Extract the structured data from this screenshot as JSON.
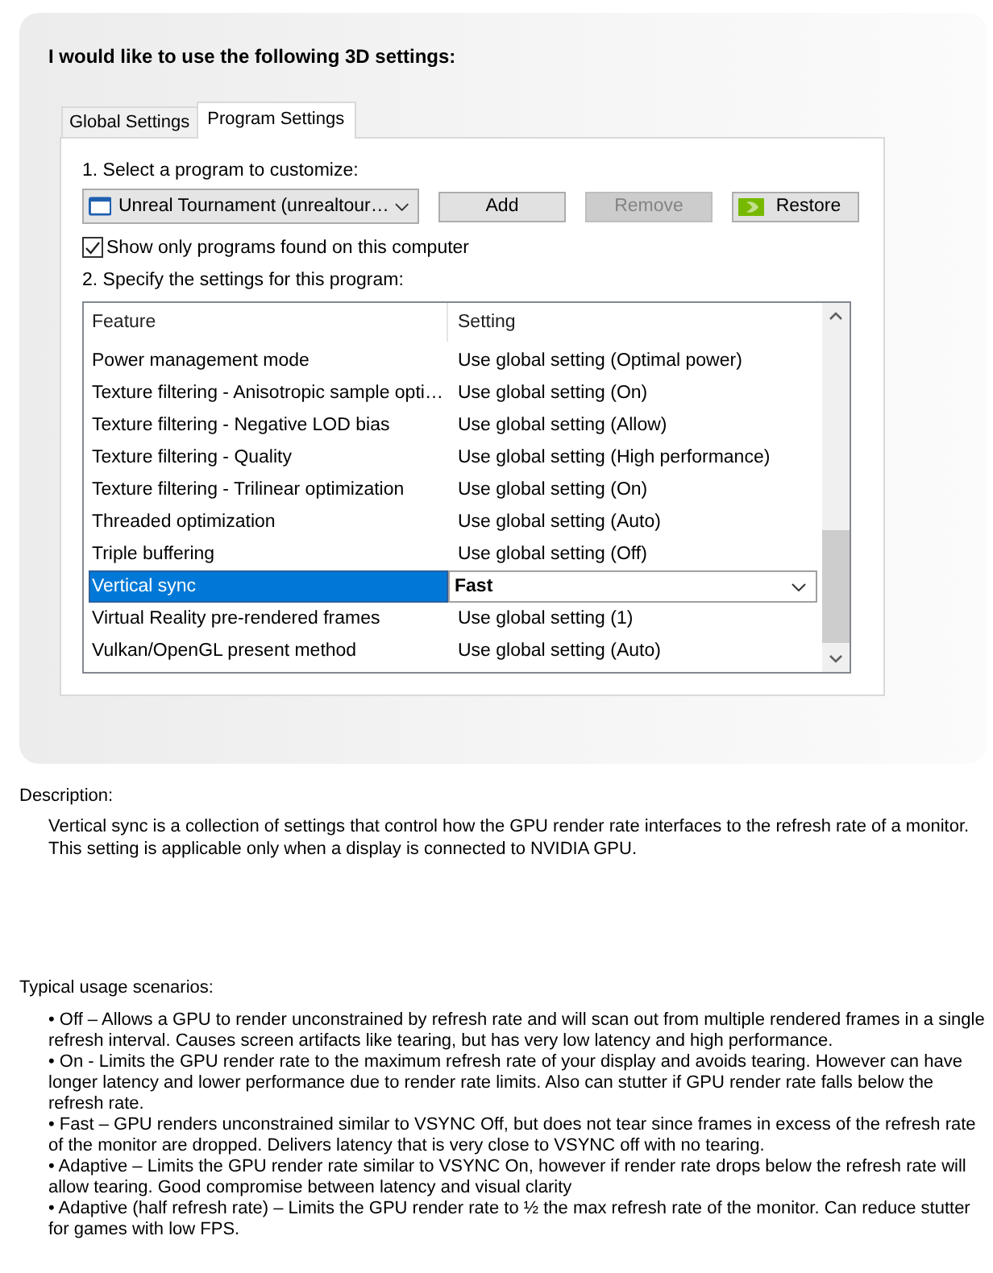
{
  "heading": "I would like to use the following 3D settings:",
  "tabs": [
    {
      "label": "Global Settings",
      "selected": false
    },
    {
      "label": "Program Settings",
      "selected": true
    }
  ],
  "program_section": {
    "label": "1. Select a program to customize:",
    "program_dropdown": {
      "value": "Unreal Tournament (unrealtour…"
    },
    "buttons": [
      {
        "label": "Add",
        "kind": "text",
        "disabled": false
      },
      {
        "label": "Remove",
        "kind": "text",
        "disabled": true
      },
      {
        "label": "Restore",
        "kind": "logo",
        "disabled": false
      }
    ],
    "show_only_found": {
      "label": "Show only programs found on this computer",
      "checked": true
    }
  },
  "settings_section": {
    "label": "2. Specify the settings for this program:",
    "columns": [
      "Feature",
      "Setting"
    ],
    "rows": [
      {
        "feature": "Power management mode",
        "setting": "Use global setting (Optimal power)",
        "selected": false
      },
      {
        "feature": "Texture filtering - Anisotropic sample opti…",
        "setting": "Use global setting (On)",
        "selected": false
      },
      {
        "feature": "Texture filtering - Negative LOD bias",
        "setting": "Use global setting (Allow)",
        "selected": false
      },
      {
        "feature": "Texture filtering - Quality",
        "setting": "Use global setting (High performance)",
        "selected": false
      },
      {
        "feature": "Texture filtering - Trilinear optimization",
        "setting": "Use global setting (On)",
        "selected": false
      },
      {
        "feature": "Threaded optimization",
        "setting": "Use global setting (Auto)",
        "selected": false
      },
      {
        "feature": "Triple buffering",
        "setting": "Use global setting (Off)",
        "selected": false
      },
      {
        "feature": "Vertical sync",
        "setting": "Fast",
        "selected": true
      },
      {
        "feature": "Virtual Reality pre-rendered frames",
        "setting": "Use global setting (1)",
        "selected": false
      },
      {
        "feature": "Vulkan/OpenGL present method",
        "setting": "Use global setting (Auto)",
        "selected": false
      }
    ]
  },
  "description": {
    "label": "Description:",
    "text": "Vertical sync is a collection of settings that control how the GPU render rate interfaces to the refresh rate of a monitor. This setting is applicable only when a display is connected to NVIDIA GPU."
  },
  "usage": {
    "label": "Typical usage scenarios:",
    "items": [
      "• Off – Allows a GPU to render unconstrained by refresh rate and will scan out from multiple rendered frames in a single refresh interval. Causes screen artifacts like tearing, but has very low latency and high performance.",
      "• On - Limits the GPU render rate to the maximum refresh rate of your display and avoids tearing. However can have longer latency and lower performance due to render rate limits. Also can stutter if GPU render rate falls below the refresh rate.",
      "• Fast – GPU renders unconstrained similar to VSYNC Off, but does not tear since frames in excess of the refresh rate of the monitor are dropped. Delivers latency that is very close to VSYNC off with no tearing.",
      "• Adaptive – Limits the GPU render rate similar to VSYNC On, however if render rate drops below the refresh rate will allow tearing. Good compromise between latency and visual clarity",
      "• Adaptive (half refresh rate) – Limits the GPU render rate to ½ the max refresh rate of the monitor. Can reduce stutter for games with low FPS."
    ]
  }
}
